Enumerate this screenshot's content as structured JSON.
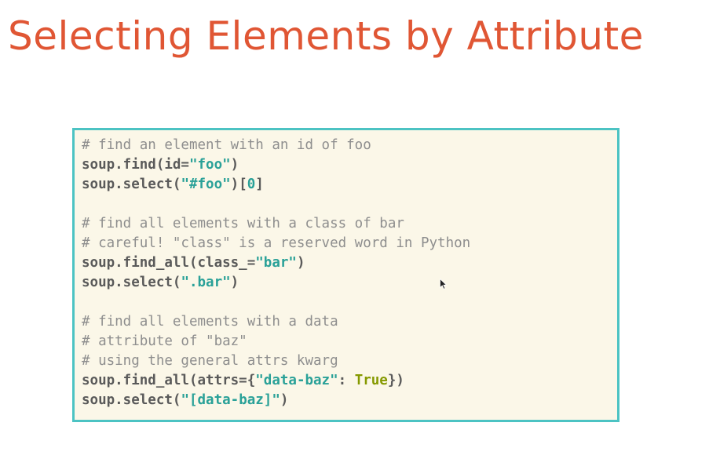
{
  "slide": {
    "title": "Selecting Elements by Attribute",
    "title_color": "#e05634"
  },
  "code_block": {
    "border_color": "#4cc3c3",
    "background_color": "#fbf7e8",
    "lines": [
      {
        "tokens": [
          {
            "t": "# find an element with an id of foo",
            "k": "comment"
          }
        ]
      },
      {
        "tokens": [
          {
            "t": "soup.find(id=",
            "k": "plain"
          },
          {
            "t": "\"foo\"",
            "k": "string"
          },
          {
            "t": ")",
            "k": "plain"
          }
        ]
      },
      {
        "tokens": [
          {
            "t": "soup.select(",
            "k": "plain"
          },
          {
            "t": "\"#foo\"",
            "k": "string"
          },
          {
            "t": ")[",
            "k": "plain"
          },
          {
            "t": "0",
            "k": "number"
          },
          {
            "t": "]",
            "k": "plain"
          }
        ]
      },
      {
        "tokens": []
      },
      {
        "tokens": [
          {
            "t": "# find all elements with a class of bar",
            "k": "comment"
          }
        ]
      },
      {
        "tokens": [
          {
            "t": "# careful! \"class\" is a reserved word in Python",
            "k": "comment"
          }
        ]
      },
      {
        "tokens": [
          {
            "t": "soup.find_all(class_=",
            "k": "plain"
          },
          {
            "t": "\"bar\"",
            "k": "string"
          },
          {
            "t": ")",
            "k": "plain"
          }
        ]
      },
      {
        "tokens": [
          {
            "t": "soup.select(",
            "k": "plain"
          },
          {
            "t": "\".bar\"",
            "k": "string"
          },
          {
            "t": ")",
            "k": "plain"
          }
        ]
      },
      {
        "tokens": []
      },
      {
        "tokens": [
          {
            "t": "# find all elements with a data",
            "k": "comment"
          }
        ]
      },
      {
        "tokens": [
          {
            "t": "# attribute of \"baz\"",
            "k": "comment"
          }
        ]
      },
      {
        "tokens": [
          {
            "t": "# using the general attrs kwarg",
            "k": "comment"
          }
        ]
      },
      {
        "tokens": [
          {
            "t": "soup.find_all(attrs={",
            "k": "plain"
          },
          {
            "t": "\"data-baz\"",
            "k": "string"
          },
          {
            "t": ": ",
            "k": "plain"
          },
          {
            "t": "True",
            "k": "keyword"
          },
          {
            "t": "})",
            "k": "plain"
          }
        ]
      },
      {
        "tokens": [
          {
            "t": "soup.select(",
            "k": "plain"
          },
          {
            "t": "\"[data-baz]\"",
            "k": "string"
          },
          {
            "t": ")",
            "k": "plain"
          }
        ]
      }
    ]
  },
  "icons": {
    "mouse_cursor": "arrow-cursor-icon"
  }
}
